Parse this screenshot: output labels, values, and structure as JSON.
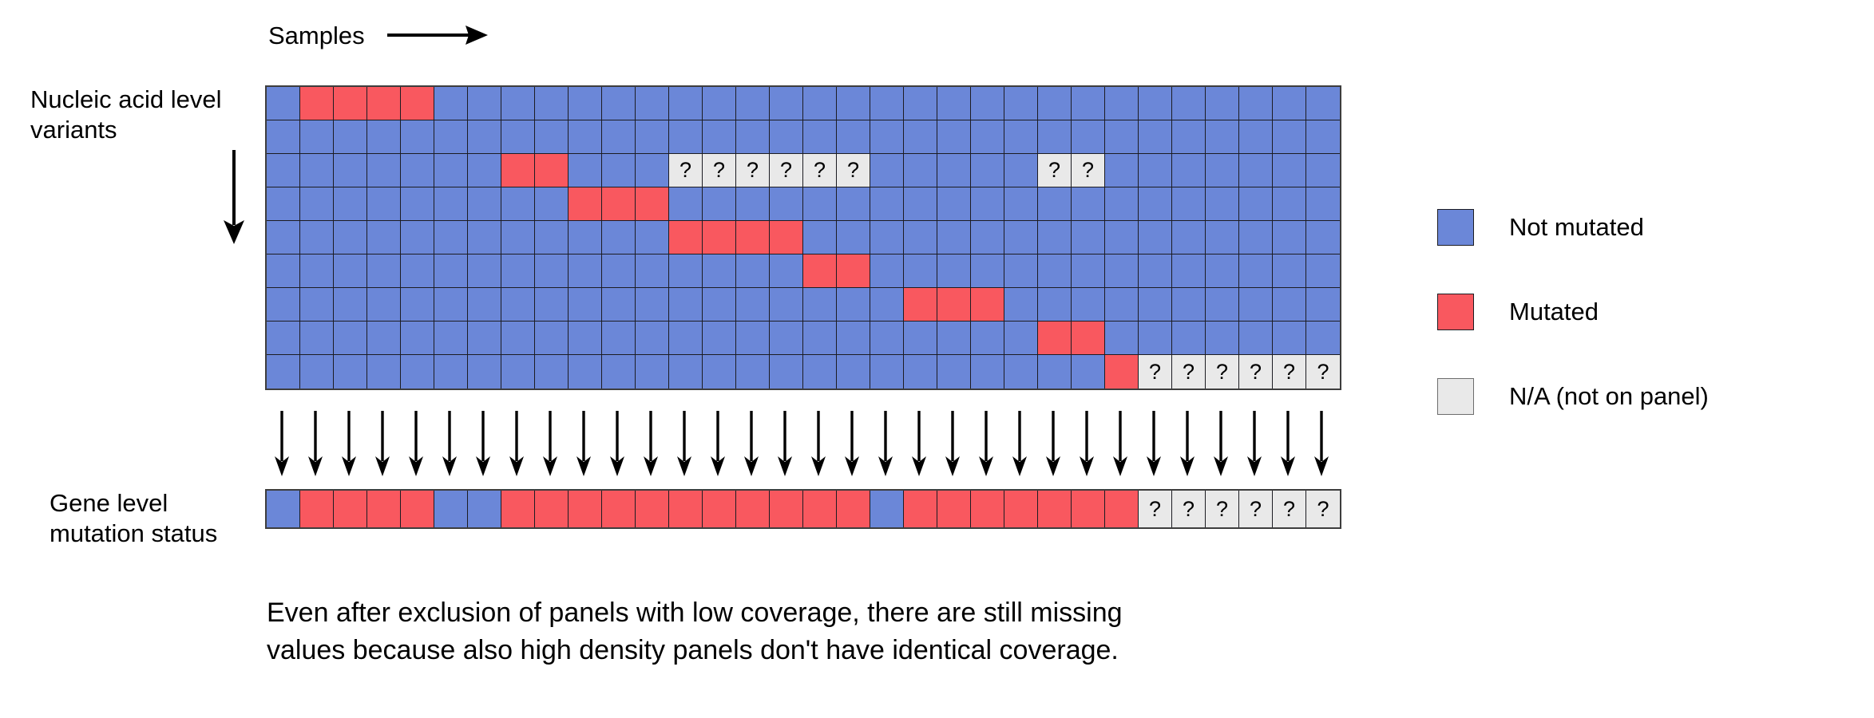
{
  "header": {
    "samples_label": "Samples",
    "samples_arrow_icon": "right-arrow-icon"
  },
  "axis_labels": {
    "nucleic_line1": "Nucleic acid level",
    "nucleic_line2": "variants",
    "nucleic_down_arrow_icon": "down-arrow-icon",
    "gene_line1": "Gene level",
    "gene_line2": "mutation status"
  },
  "legend": {
    "items": [
      {
        "swatch": "blue",
        "label": "Not mutated",
        "color": "#6b87d8"
      },
      {
        "swatch": "red",
        "label": "Mutated",
        "color": "#f9585f"
      },
      {
        "swatch": "na",
        "label": "N/A (not on panel)",
        "color": "#e9e9e9"
      }
    ]
  },
  "caption": {
    "line1": "Even after exclusion of panels with low coverage, there are still missing",
    "line2": "values because also high density panels don't have identical coverage."
  },
  "chart_data": {
    "type": "heatmap",
    "title": "",
    "xlabel": "Samples",
    "ylabel": "Nucleic acid level variants",
    "n_columns": 32,
    "n_rows": 9,
    "na_glyph": "?",
    "value_legend": {
      "0": "Not mutated",
      "1": "Mutated",
      "na": "N/A (not on panel)"
    },
    "colors": {
      "not_mutated": "#6b87d8",
      "mutated": "#f9585f",
      "na": "#e9e9e9",
      "grid_line": "#1c1c22",
      "border": "#3d3d3d"
    },
    "matrix": [
      [
        "0",
        "1",
        "1",
        "1",
        "1",
        "0",
        "0",
        "0",
        "0",
        "0",
        "0",
        "0",
        "0",
        "0",
        "0",
        "0",
        "0",
        "0",
        "0",
        "0",
        "0",
        "0",
        "0",
        "0",
        "0",
        "0",
        "0",
        "0",
        "0",
        "0",
        "0",
        "0"
      ],
      [
        "0",
        "0",
        "0",
        "0",
        "0",
        "0",
        "0",
        "0",
        "0",
        "0",
        "0",
        "0",
        "0",
        "0",
        "0",
        "0",
        "0",
        "0",
        "0",
        "0",
        "0",
        "0",
        "0",
        "0",
        "0",
        "0",
        "0",
        "0",
        "0",
        "0",
        "0",
        "0"
      ],
      [
        "0",
        "0",
        "0",
        "0",
        "0",
        "0",
        "0",
        "1",
        "1",
        "0",
        "0",
        "0",
        "na",
        "na",
        "na",
        "na",
        "na",
        "na",
        "0",
        "0",
        "0",
        "0",
        "0",
        "na",
        "na",
        "0",
        "0",
        "0",
        "0",
        "0",
        "0",
        "0"
      ],
      [
        "0",
        "0",
        "0",
        "0",
        "0",
        "0",
        "0",
        "0",
        "0",
        "1",
        "1",
        "1",
        "0",
        "0",
        "0",
        "0",
        "0",
        "0",
        "0",
        "0",
        "0",
        "0",
        "0",
        "0",
        "0",
        "0",
        "0",
        "0",
        "0",
        "0",
        "0",
        "0"
      ],
      [
        "0",
        "0",
        "0",
        "0",
        "0",
        "0",
        "0",
        "0",
        "0",
        "0",
        "0",
        "0",
        "1",
        "1",
        "1",
        "1",
        "0",
        "0",
        "0",
        "0",
        "0",
        "0",
        "0",
        "0",
        "0",
        "0",
        "0",
        "0",
        "0",
        "0",
        "0",
        "0"
      ],
      [
        "0",
        "0",
        "0",
        "0",
        "0",
        "0",
        "0",
        "0",
        "0",
        "0",
        "0",
        "0",
        "0",
        "0",
        "0",
        "0",
        "1",
        "1",
        "0",
        "0",
        "0",
        "0",
        "0",
        "0",
        "0",
        "0",
        "0",
        "0",
        "0",
        "0",
        "0",
        "0"
      ],
      [
        "0",
        "0",
        "0",
        "0",
        "0",
        "0",
        "0",
        "0",
        "0",
        "0",
        "0",
        "0",
        "0",
        "0",
        "0",
        "0",
        "0",
        "0",
        "0",
        "1",
        "1",
        "1",
        "0",
        "0",
        "0",
        "0",
        "0",
        "0",
        "0",
        "0",
        "0",
        "0"
      ],
      [
        "0",
        "0",
        "0",
        "0",
        "0",
        "0",
        "0",
        "0",
        "0",
        "0",
        "0",
        "0",
        "0",
        "0",
        "0",
        "0",
        "0",
        "0",
        "0",
        "0",
        "0",
        "0",
        "0",
        "1",
        "1",
        "0",
        "0",
        "0",
        "0",
        "0",
        "0",
        "0"
      ],
      [
        "0",
        "0",
        "0",
        "0",
        "0",
        "0",
        "0",
        "0",
        "0",
        "0",
        "0",
        "0",
        "0",
        "0",
        "0",
        "0",
        "0",
        "0",
        "0",
        "0",
        "0",
        "0",
        "0",
        "0",
        "0",
        "1",
        "na",
        "na",
        "na",
        "na",
        "na",
        "na"
      ]
    ],
    "gene_level_row": [
      "0",
      "1",
      "1",
      "1",
      "1",
      "0",
      "0",
      "1",
      "1",
      "1",
      "1",
      "1",
      "1",
      "1",
      "1",
      "1",
      "1",
      "1",
      "0",
      "1",
      "1",
      "1",
      "1",
      "1",
      "1",
      "1",
      "na",
      "na",
      "na",
      "na",
      "na",
      "na"
    ],
    "arrow_count": 32,
    "arrow_icon": "down-arrow-icon"
  }
}
